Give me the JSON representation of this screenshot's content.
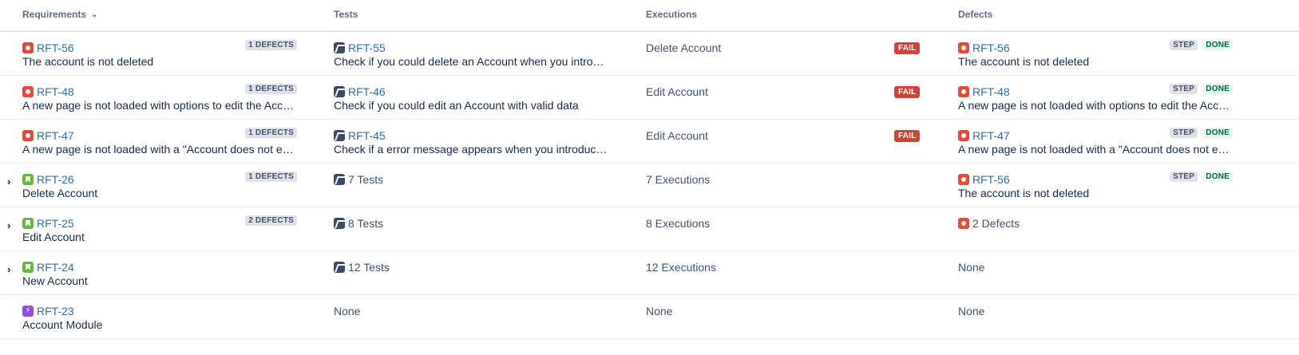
{
  "header": {
    "requirements": "Requirements",
    "tests": "Tests",
    "executions": "Executions",
    "defects": "Defects"
  },
  "rows": [
    {
      "req": {
        "key": "RFT-56",
        "summary": "The account is not deleted",
        "badge": "1 DEFECTS",
        "icon": "bug-icon"
      },
      "test": {
        "key": "RFT-55",
        "summary": "Check if you could delete an Account when you introdu…"
      },
      "exec": {
        "text": "Delete Account",
        "status": "FAIL"
      },
      "defect": {
        "key": "RFT-56",
        "summary": "The account is not deleted",
        "step": "STEP",
        "done": "DONE"
      }
    },
    {
      "req": {
        "key": "RFT-48",
        "summary": "A new page is not loaded with options to edit the Account",
        "badge": "1 DEFECTS",
        "icon": "bug-icon"
      },
      "test": {
        "key": "RFT-46",
        "summary": "Check if you could edit an Account with valid data"
      },
      "exec": {
        "text": "Edit Account",
        "status": "FAIL"
      },
      "defect": {
        "key": "RFT-48",
        "summary": "A new page is not loaded with options to edit the Account",
        "step": "STEP",
        "done": "DONE"
      }
    },
    {
      "req": {
        "key": "RFT-47",
        "summary": "A new page is not loaded with a \"Account does not exi…",
        "badge": "1 DEFECTS",
        "icon": "bug-icon"
      },
      "test": {
        "key": "RFT-45",
        "summary": "Check if a error message appears when you introduce …"
      },
      "exec": {
        "text": "Edit Account",
        "status": "FAIL"
      },
      "defect": {
        "key": "RFT-47",
        "summary": "A new page is not loaded with a \"Account does not exi…",
        "step": "STEP",
        "done": "DONE"
      }
    },
    {
      "req": {
        "key": "RFT-26",
        "summary": "Delete Account",
        "badge": "1 DEFECTS",
        "icon": "story-icon"
      },
      "test": {
        "text": "7 Tests"
      },
      "exec": {
        "text": "7 Executions"
      },
      "defect": {
        "key": "RFT-56",
        "summary": "The account is not deleted",
        "step": "STEP",
        "done": "DONE"
      }
    },
    {
      "req": {
        "key": "RFT-25",
        "summary": "Edit Account",
        "badge": "2 DEFECTS",
        "icon": "story-icon"
      },
      "test": {
        "text": "8 Tests"
      },
      "exec": {
        "text": "8 Executions"
      },
      "defect": {
        "text": "2 Defects"
      }
    },
    {
      "req": {
        "key": "RFT-24",
        "summary": "New Account",
        "icon": "story-icon"
      },
      "test": {
        "text": "12 Tests"
      },
      "exec": {
        "text": "12 Executions"
      },
      "defect": {
        "text": "None"
      }
    },
    {
      "req": {
        "key": "RFT-23",
        "summary": "Account Module",
        "icon": "epic-icon"
      },
      "test": {
        "text": "None"
      },
      "exec": {
        "text": "None"
      },
      "defect": {
        "text": "None"
      }
    }
  ]
}
